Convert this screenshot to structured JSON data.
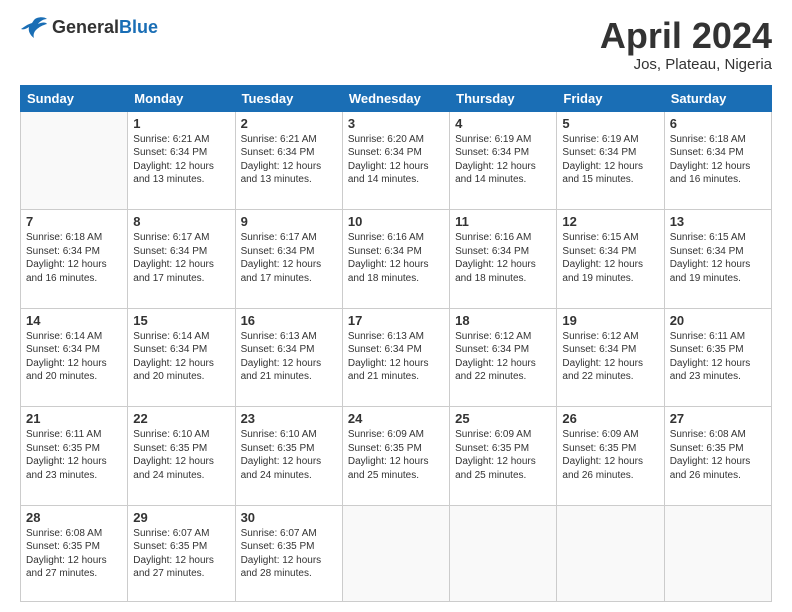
{
  "header": {
    "logo_general": "General",
    "logo_blue": "Blue",
    "title": "April 2024",
    "subtitle": "Jos, Plateau, Nigeria"
  },
  "weekdays": [
    "Sunday",
    "Monday",
    "Tuesday",
    "Wednesday",
    "Thursday",
    "Friday",
    "Saturday"
  ],
  "weeks": [
    [
      {
        "day": "",
        "info": ""
      },
      {
        "day": "1",
        "info": "Sunrise: 6:21 AM\nSunset: 6:34 PM\nDaylight: 12 hours\nand 13 minutes."
      },
      {
        "day": "2",
        "info": "Sunrise: 6:21 AM\nSunset: 6:34 PM\nDaylight: 12 hours\nand 13 minutes."
      },
      {
        "day": "3",
        "info": "Sunrise: 6:20 AM\nSunset: 6:34 PM\nDaylight: 12 hours\nand 14 minutes."
      },
      {
        "day": "4",
        "info": "Sunrise: 6:19 AM\nSunset: 6:34 PM\nDaylight: 12 hours\nand 14 minutes."
      },
      {
        "day": "5",
        "info": "Sunrise: 6:19 AM\nSunset: 6:34 PM\nDaylight: 12 hours\nand 15 minutes."
      },
      {
        "day": "6",
        "info": "Sunrise: 6:18 AM\nSunset: 6:34 PM\nDaylight: 12 hours\nand 16 minutes."
      }
    ],
    [
      {
        "day": "7",
        "info": "Sunrise: 6:18 AM\nSunset: 6:34 PM\nDaylight: 12 hours\nand 16 minutes."
      },
      {
        "day": "8",
        "info": "Sunrise: 6:17 AM\nSunset: 6:34 PM\nDaylight: 12 hours\nand 17 minutes."
      },
      {
        "day": "9",
        "info": "Sunrise: 6:17 AM\nSunset: 6:34 PM\nDaylight: 12 hours\nand 17 minutes."
      },
      {
        "day": "10",
        "info": "Sunrise: 6:16 AM\nSunset: 6:34 PM\nDaylight: 12 hours\nand 18 minutes."
      },
      {
        "day": "11",
        "info": "Sunrise: 6:16 AM\nSunset: 6:34 PM\nDaylight: 12 hours\nand 18 minutes."
      },
      {
        "day": "12",
        "info": "Sunrise: 6:15 AM\nSunset: 6:34 PM\nDaylight: 12 hours\nand 19 minutes."
      },
      {
        "day": "13",
        "info": "Sunrise: 6:15 AM\nSunset: 6:34 PM\nDaylight: 12 hours\nand 19 minutes."
      }
    ],
    [
      {
        "day": "14",
        "info": "Sunrise: 6:14 AM\nSunset: 6:34 PM\nDaylight: 12 hours\nand 20 minutes."
      },
      {
        "day": "15",
        "info": "Sunrise: 6:14 AM\nSunset: 6:34 PM\nDaylight: 12 hours\nand 20 minutes."
      },
      {
        "day": "16",
        "info": "Sunrise: 6:13 AM\nSunset: 6:34 PM\nDaylight: 12 hours\nand 21 minutes."
      },
      {
        "day": "17",
        "info": "Sunrise: 6:13 AM\nSunset: 6:34 PM\nDaylight: 12 hours\nand 21 minutes."
      },
      {
        "day": "18",
        "info": "Sunrise: 6:12 AM\nSunset: 6:34 PM\nDaylight: 12 hours\nand 22 minutes."
      },
      {
        "day": "19",
        "info": "Sunrise: 6:12 AM\nSunset: 6:34 PM\nDaylight: 12 hours\nand 22 minutes."
      },
      {
        "day": "20",
        "info": "Sunrise: 6:11 AM\nSunset: 6:35 PM\nDaylight: 12 hours\nand 23 minutes."
      }
    ],
    [
      {
        "day": "21",
        "info": "Sunrise: 6:11 AM\nSunset: 6:35 PM\nDaylight: 12 hours\nand 23 minutes."
      },
      {
        "day": "22",
        "info": "Sunrise: 6:10 AM\nSunset: 6:35 PM\nDaylight: 12 hours\nand 24 minutes."
      },
      {
        "day": "23",
        "info": "Sunrise: 6:10 AM\nSunset: 6:35 PM\nDaylight: 12 hours\nand 24 minutes."
      },
      {
        "day": "24",
        "info": "Sunrise: 6:09 AM\nSunset: 6:35 PM\nDaylight: 12 hours\nand 25 minutes."
      },
      {
        "day": "25",
        "info": "Sunrise: 6:09 AM\nSunset: 6:35 PM\nDaylight: 12 hours\nand 25 minutes."
      },
      {
        "day": "26",
        "info": "Sunrise: 6:09 AM\nSunset: 6:35 PM\nDaylight: 12 hours\nand 26 minutes."
      },
      {
        "day": "27",
        "info": "Sunrise: 6:08 AM\nSunset: 6:35 PM\nDaylight: 12 hours\nand 26 minutes."
      }
    ],
    [
      {
        "day": "28",
        "info": "Sunrise: 6:08 AM\nSunset: 6:35 PM\nDaylight: 12 hours\nand 27 minutes."
      },
      {
        "day": "29",
        "info": "Sunrise: 6:07 AM\nSunset: 6:35 PM\nDaylight: 12 hours\nand 27 minutes."
      },
      {
        "day": "30",
        "info": "Sunrise: 6:07 AM\nSunset: 6:35 PM\nDaylight: 12 hours\nand 28 minutes."
      },
      {
        "day": "",
        "info": ""
      },
      {
        "day": "",
        "info": ""
      },
      {
        "day": "",
        "info": ""
      },
      {
        "day": "",
        "info": ""
      }
    ]
  ]
}
